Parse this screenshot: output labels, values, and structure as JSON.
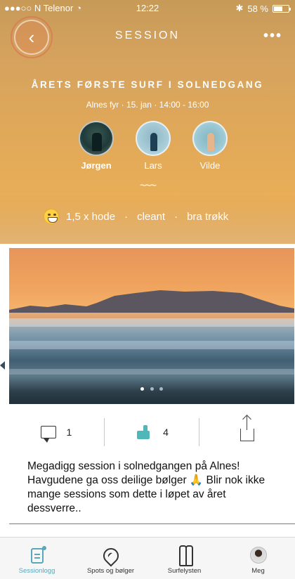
{
  "status_bar": {
    "carrier": "●●●○○ N Telenor",
    "time": "12:22",
    "battery": "58 %"
  },
  "header": {
    "title": "SESSION",
    "more": "•••"
  },
  "session": {
    "title": "ÅRETS FØRSTE SURF I SOLNEDGANG",
    "meta": "Alnes fyr · 15. jan · 14:00 - 16:00",
    "participants": [
      {
        "name": "Jørgen"
      },
      {
        "name": "Lars"
      },
      {
        "name": "Vilde"
      }
    ],
    "wave_symbol": "~~~",
    "conditions": [
      "1,5 x hode",
      "cleant",
      "bra trøkk"
    ],
    "separator": "·"
  },
  "photo": {
    "slides": 3,
    "active_slide": 1
  },
  "actions": {
    "comments": "1",
    "likes": "4"
  },
  "description": "Megadigg session i solnedgangen på Alnes! Havgudene ga oss deilige bølger 🙏 Blir nok ikke mange sessions som dette i løpet av året dessverre..",
  "tabs": [
    {
      "label": "Sessionlogg",
      "icon": "log-icon",
      "active": true
    },
    {
      "label": "Spots og bølger",
      "icon": "spot-icon",
      "active": false
    },
    {
      "label": "Surfelysten",
      "icon": "surf-icon",
      "active": false
    },
    {
      "label": "Meg",
      "icon": "avatar-icon",
      "active": false
    }
  ],
  "colors": {
    "accent": "#5aa7b7",
    "header_gradient_top": "#c79a58",
    "header_gradient_bottom": "#e9ae57"
  }
}
